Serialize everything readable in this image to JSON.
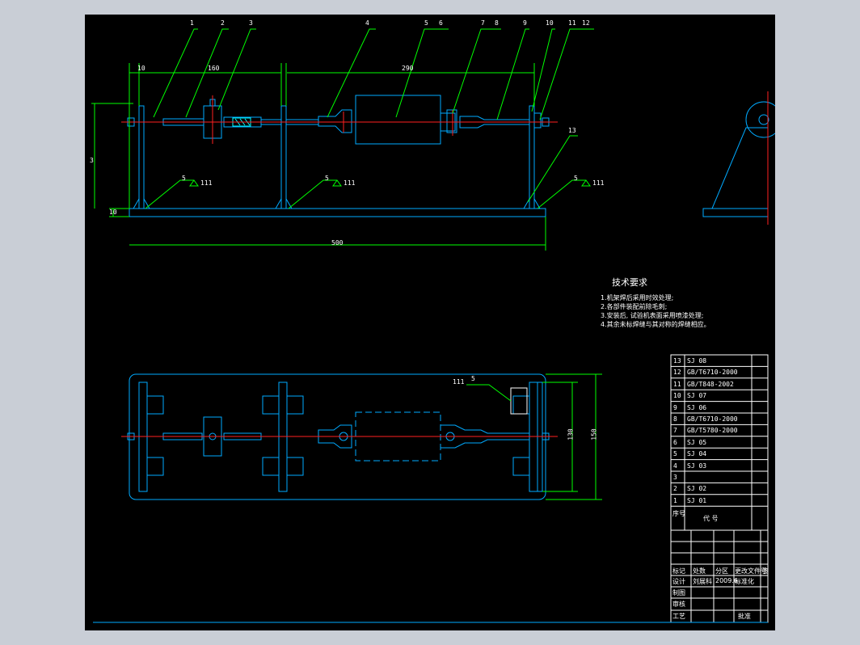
{
  "colors": {
    "background": "#000000",
    "frame": "#c9ced6",
    "part_outline": "#00aaff",
    "centerline": "#ff2020",
    "dimension": "#00ff00",
    "text": "#ffffff",
    "section_hatch": "#00ffff"
  },
  "balloons": [
    "1",
    "2",
    "3",
    "4",
    "5",
    "6",
    "7",
    "8",
    "9",
    "10",
    "11",
    "12",
    "13"
  ],
  "front_view": {
    "dims": {
      "left_offset": "10",
      "span_left": "160",
      "span_right": "290",
      "height": "3",
      "base_thickness": "10",
      "overall_length": "500"
    },
    "weld_symbols": [
      "5",
      "5",
      "5"
    ],
    "weld_note": "111"
  },
  "top_view": {
    "dims": {
      "inner_width": "130",
      "outer_width": "150"
    },
    "weld_symbol": "5",
    "weld_note": "111"
  },
  "tech_requirements": {
    "title": "技术要求",
    "items": [
      "1.机架焊后采用时效处理;",
      "2.各部件装配前除毛刺;",
      "3.安装后, 试验机表面采用喷漆处理;",
      "4.其余未标焊缝与其对称的焊缝相应。"
    ]
  },
  "parts_list": {
    "rows": [
      {
        "no": "13",
        "code": "SJ 08"
      },
      {
        "no": "12",
        "code": "GB/T6710-2000"
      },
      {
        "no": "11",
        "code": "GB/T848-2002"
      },
      {
        "no": "10",
        "code": "SJ 07"
      },
      {
        "no": "9",
        "code": "SJ 06"
      },
      {
        "no": "8",
        "code": "GB/T6710-2000"
      },
      {
        "no": "7",
        "code": "GB/T5780-2000"
      },
      {
        "no": "6",
        "code": "SJ 05"
      },
      {
        "no": "5",
        "code": "SJ 04"
      },
      {
        "no": "4",
        "code": "SJ 03"
      },
      {
        "no": "3",
        "code": ""
      },
      {
        "no": "2",
        "code": "SJ 02"
      },
      {
        "no": "1",
        "code": "SJ 01"
      }
    ],
    "header_no": "序号",
    "header_code": "代 号"
  },
  "title_block": {
    "mark": "标记",
    "count": "处数",
    "zone": "分区",
    "change_doc": "更改文件号",
    "sign": "签",
    "design": "设计",
    "designer": "刘展科",
    "date": "2009.6",
    "std": "标准化",
    "draw": "制图",
    "check": "审核",
    "process": "工艺",
    "approve": "批准"
  }
}
